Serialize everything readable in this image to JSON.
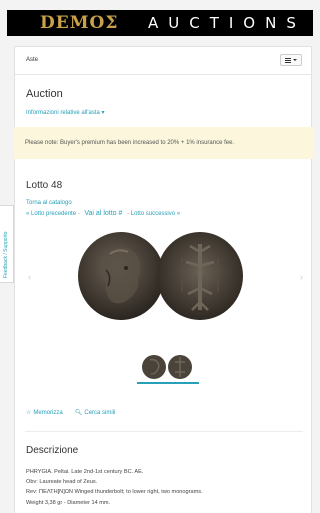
{
  "header": {
    "logo_left": "DEMOΣ",
    "logo_right": "AUCTIONS"
  },
  "subnav": {
    "title": "Aste"
  },
  "auction": {
    "title": "Auction",
    "info_link": "Informazioni relative all'asta ▾",
    "notice": "Please note: Buyer's premium has been increased to 20% + 1% insurance fee."
  },
  "lot": {
    "title": "Lotto 48",
    "catalog_link": "Torna al catalogo",
    "prev_link": "« Lotto precedente",
    "goto_link": "Vai al lotto #",
    "next_link": "Lotto successivo »"
  },
  "feedback": {
    "label": "Feedback / Supporto"
  },
  "actions": {
    "watch": "Memorizza",
    "search_similar": "Cerca simili"
  },
  "description": {
    "title": "Descrizione",
    "lines": [
      "PHRYGIA. Peltai. Late 2nd-1st century BC. AE.",
      "Obv: Laureate head of Zeus.",
      "Rev: ΠΕΛΤΗ[Ν]ΩΝ Winged thunderbolt; to lower right, two monograms.",
      "Weight 3,38 gr - Diameter 14 mm."
    ]
  },
  "colors": {
    "accent": "#27a0b8",
    "logo_gold": "#c9a14a",
    "notice_bg": "#fbf6dc"
  }
}
